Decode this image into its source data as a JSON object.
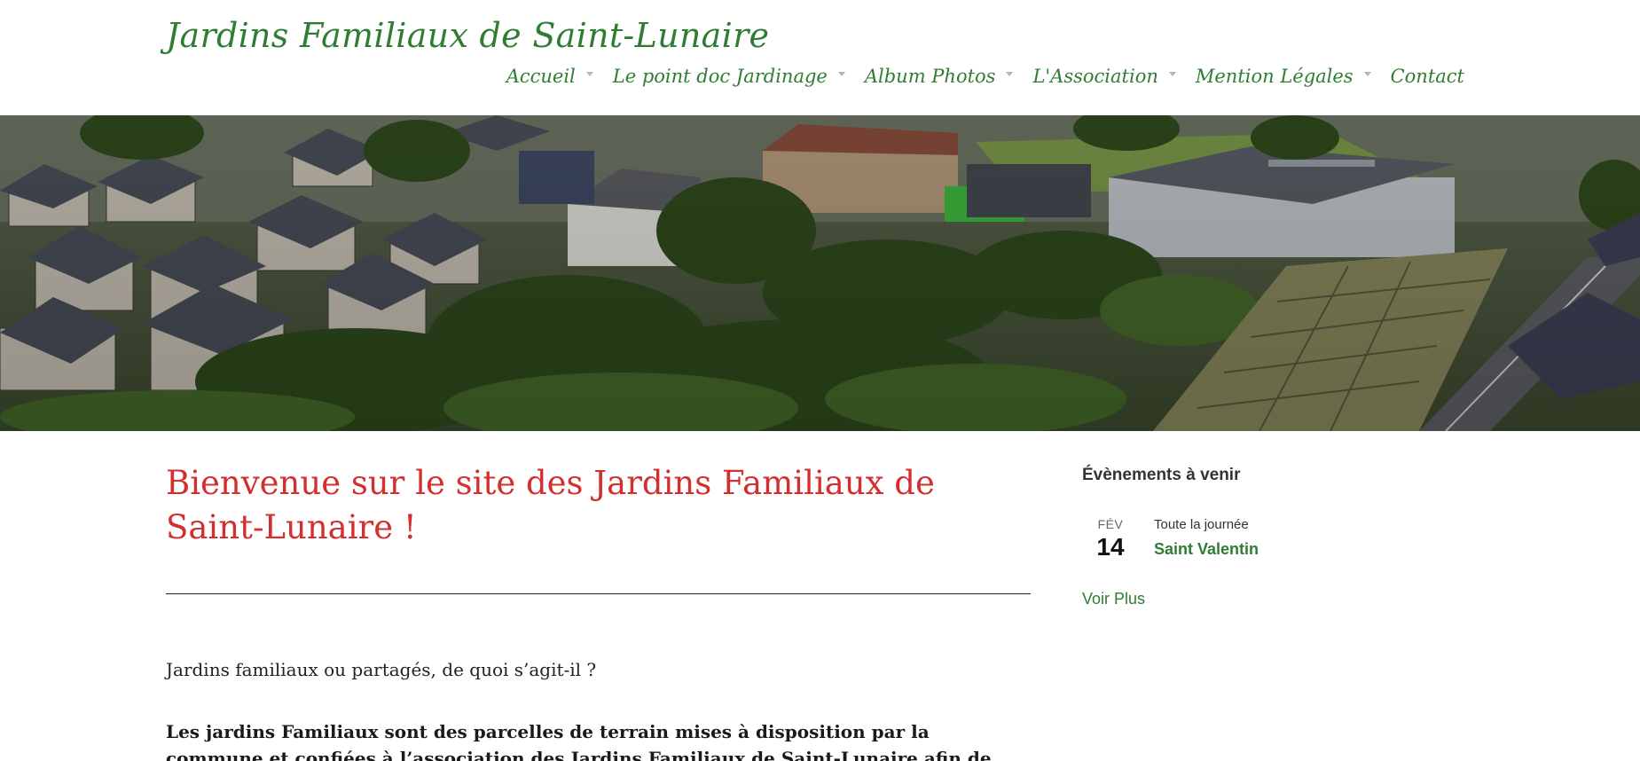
{
  "site": {
    "title": "Jardins Familiaux de Saint-Lunaire"
  },
  "nav": {
    "items": [
      {
        "label": "Accueil",
        "has_submenu": true
      },
      {
        "label": "Le point doc Jardinage",
        "has_submenu": true
      },
      {
        "label": "Album Photos",
        "has_submenu": true
      },
      {
        "label": "L'Association",
        "has_submenu": true
      },
      {
        "label": "Mention Légales",
        "has_submenu": true
      },
      {
        "label": "Contact",
        "has_submenu": false
      }
    ]
  },
  "main": {
    "title": "Bienvenue sur le site des Jardins Familiaux de Saint-Lunaire !",
    "intro_question": "Jardins familiaux ou partagés, de quoi s’agit-il ?",
    "intro_paragraph": "Les jardins Familiaux sont des parcelles de terrain mises à disposition par la commune et confiées à l’association des Jardins Familiaux de Saint-Lunaire afin de gérer leur fonctionnement."
  },
  "sidebar": {
    "widget_title": "Évènements à venir",
    "events": [
      {
        "month": "FÉV",
        "day": "14",
        "time": "Toute la journée",
        "name": "Saint Valentin"
      }
    ],
    "see_more": "Voir Plus"
  },
  "colors": {
    "brand_green": "#2e7d32",
    "title_red": "#d32f2f",
    "caret_gray": "#b5b5b5"
  },
  "icons": {
    "nav_caret": "chevron-down-icon"
  }
}
